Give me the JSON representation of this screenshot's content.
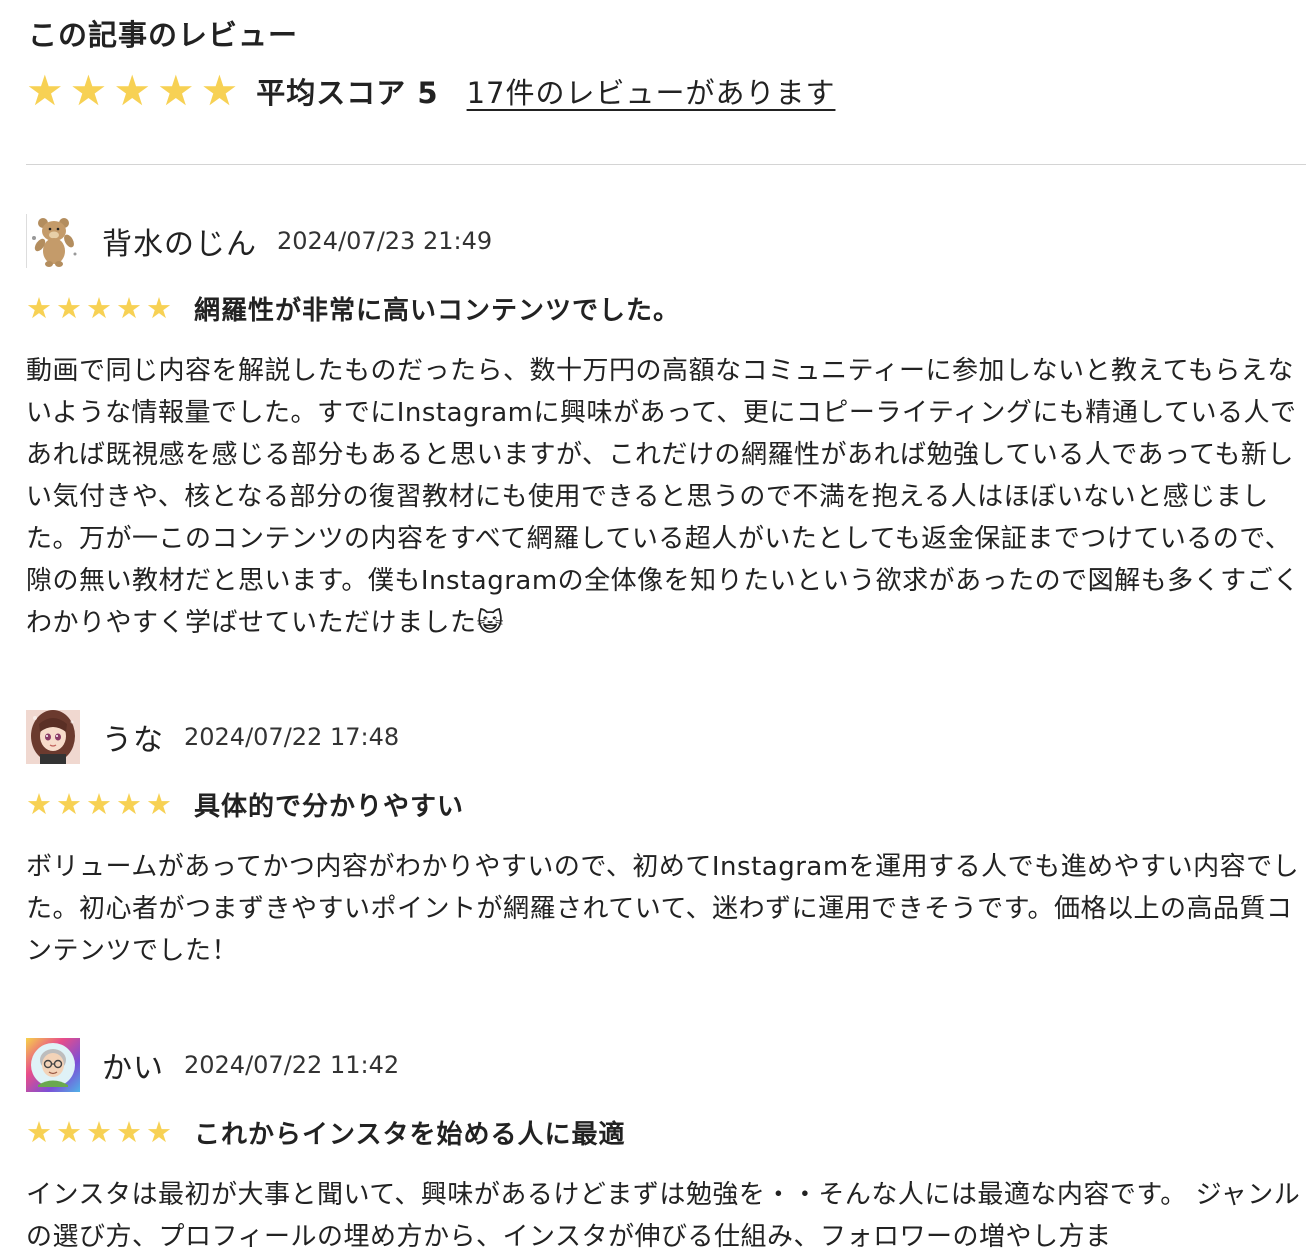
{
  "section": {
    "title": "この記事のレビュー",
    "average_label": "平均スコア 5",
    "review_count_link": "17件のレビューがあります",
    "rating": 5,
    "star_color": "#f7d154"
  },
  "reviews": [
    {
      "reviewer": "背水のじん",
      "date": "2024/07/23 21:49",
      "rating": 5,
      "title": "網羅性が非常に高いコンテンツでした。",
      "body": "動画で同じ内容を解説したものだったら、数十万円の高額なコミュニティーに参加しないと教えてもらえないような情報量でした。すでにInstagramに興味があって、更にコピーライティングにも精通している人であれば既視感を感じる部分もあると思いますが、これだけの網羅性があれば勉強している人であっても新しい気付きや、核となる部分の復習教材にも使用できると思うので不満を抱える人はほぼいないと感じました。万が一このコンテンツの内容をすべて網羅している超人がいたとしても返金保証までつけているので、隙の無い教材だと思います。僕もInstagramの全体像を知りたいという欲求があったので図解も多くすごくわかりやすく学ばせていただけました😺",
      "avatar_icon": "bear-avatar-icon"
    },
    {
      "reviewer": "うな",
      "date": "2024/07/22 17:48",
      "rating": 5,
      "title": "具体的で分かりやすい",
      "body": "ボリュームがあってかつ内容がわかりやすいので、初めてInstagramを運用する人でも進めやすい内容でした。初心者がつまずきやすいポイントが網羅されていて、迷わずに運用できそうです。価格以上の高品質コンテンツでした！",
      "avatar_icon": "anime-girl-avatar-icon"
    },
    {
      "reviewer": "かい",
      "date": "2024/07/22 11:42",
      "rating": 5,
      "title": "これからインスタを始める人に最適",
      "body": "インスタは最初が大事と聞いて、興味があるけどまずは勉強を・・そんな人には最適な内容です。 ジャンルの選び方、プロフィールの埋め方から、インスタが伸びる仕組み、フォロワーの増やし方ま",
      "avatar_icon": "elderly-man-avatar-icon"
    }
  ]
}
